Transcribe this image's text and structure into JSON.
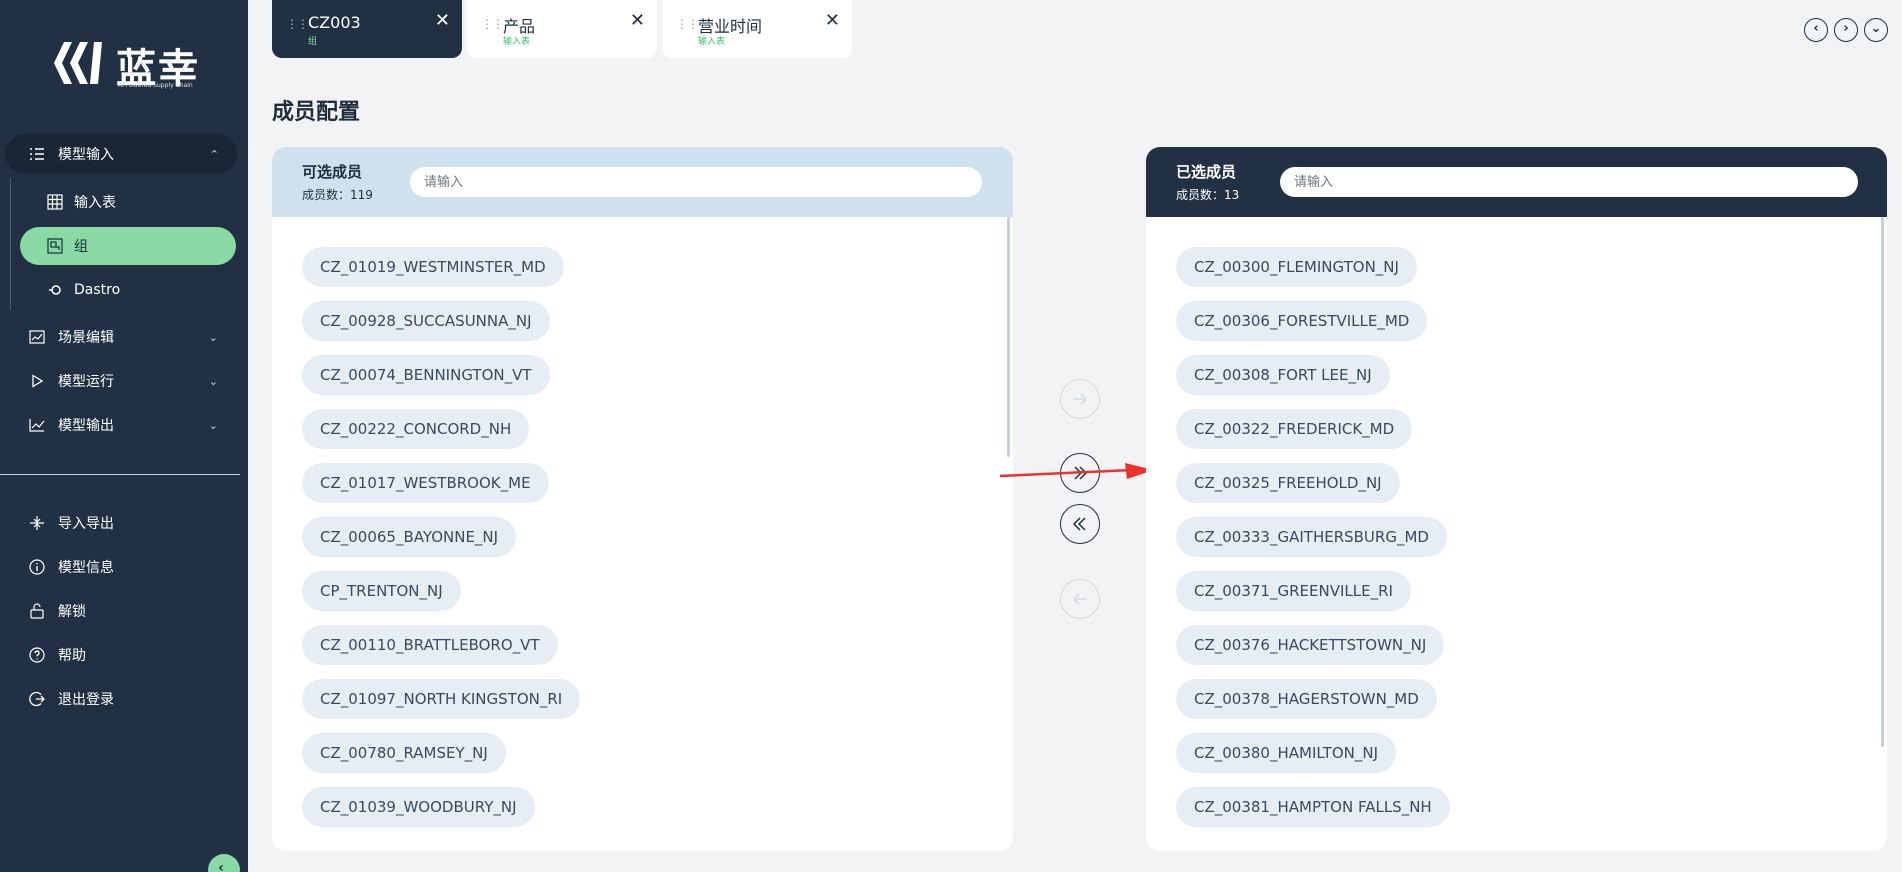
{
  "brand": {
    "name": "蓝幸",
    "tagline": "AI Powered Supply Chain"
  },
  "sidebar": {
    "group": {
      "label": "模型输入"
    },
    "sub_items": [
      {
        "label": "输入表"
      },
      {
        "label": "组"
      },
      {
        "label": "Dastro"
      }
    ],
    "items": [
      {
        "label": "场景编辑"
      },
      {
        "label": "模型运行"
      },
      {
        "label": "模型输出"
      }
    ],
    "bottom_items": [
      {
        "label": "导入导出"
      },
      {
        "label": "模型信息"
      },
      {
        "label": "解锁"
      },
      {
        "label": "帮助"
      },
      {
        "label": "退出登录"
      }
    ]
  },
  "tabs": [
    {
      "title": "CZ003",
      "subtitle": "组"
    },
    {
      "title": "产品",
      "subtitle": "输入表"
    },
    {
      "title": "营业时间",
      "subtitle": "输入表"
    }
  ],
  "page_title": "成员配置",
  "available": {
    "title": "可选成员",
    "count_label": "成员数：",
    "count": "119",
    "placeholder": "请输入",
    "items": [
      "CZ_01019_WESTMINSTER_MD",
      "CZ_00928_SUCCASUNNA_NJ",
      "CZ_00074_BENNINGTON_VT",
      "CZ_00222_CONCORD_NH",
      "CZ_01017_WESTBROOK_ME",
      "CZ_00065_BAYONNE_NJ",
      "CP_TRENTON_NJ",
      "CZ_00110_BRATTLEBORO_VT",
      "CZ_01097_NORTH KINGSTON_RI",
      "CZ_00780_RAMSEY_NJ",
      "CZ_01039_WOODBURY_NJ"
    ]
  },
  "selected": {
    "title": "已选成员",
    "count_label": "成员数：",
    "count": "13",
    "placeholder": "请输入",
    "items": [
      "CZ_00300_FLEMINGTON_NJ",
      "CZ_00306_FORESTVILLE_MD",
      "CZ_00308_FORT LEE_NJ",
      "CZ_00322_FREDERICK_MD",
      "CZ_00325_FREEHOLD_NJ",
      "CZ_00333_GAITHERSBURG_MD",
      "CZ_00371_GREENVILLE_RI",
      "CZ_00376_HACKETTSTOWN_NJ",
      "CZ_00378_HAGERSTOWN_MD",
      "CZ_00380_HAMILTON_NJ",
      "CZ_00381_HAMPTON FALLS_NH"
    ]
  },
  "colors": {
    "sidebar_bg": "#213043",
    "accent_green": "#88d9a3",
    "annotation_red": "#e8332f"
  }
}
